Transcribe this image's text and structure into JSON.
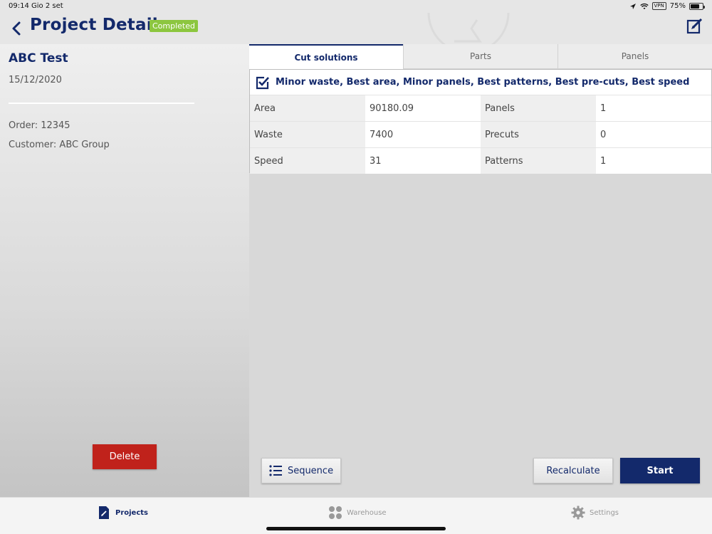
{
  "status_bar": {
    "time": "09:14",
    "date": "Gio 2 set",
    "vpn": "VPN",
    "battery": "75%",
    "battery_level": 0.75
  },
  "header": {
    "title": "Project Detail",
    "badge": "Completed",
    "badge_color": "#8cc63f",
    "accent_color": "#13296b"
  },
  "project": {
    "name": "ABC Test",
    "date": "15/12/2020",
    "order": "Order: 12345",
    "customer": "Customer: ABC Group",
    "delete_label": "Delete"
  },
  "tabs": [
    {
      "label": "Cut solutions",
      "active": true
    },
    {
      "label": "Parts",
      "active": false
    },
    {
      "label": "Panels",
      "active": false
    }
  ],
  "solution": {
    "title": "Minor waste, Best area, Minor panels, Best patterns, Best pre-cuts, Best speed",
    "rows": [
      {
        "label1": "Area",
        "value1": "90180.09",
        "label2": "Panels",
        "value2": "1"
      },
      {
        "label1": "Waste",
        "value1": "7400",
        "label2": "Precuts",
        "value2": "0"
      },
      {
        "label1": "Speed",
        "value1": "31",
        "label2": "Patterns",
        "value2": "1"
      }
    ]
  },
  "actions": {
    "sequence": "Sequence",
    "recalculate": "Recalculate",
    "start": "Start"
  },
  "tabbar": [
    {
      "label": "Projects",
      "icon": "projects-icon",
      "active": true
    },
    {
      "label": "Warehouse",
      "icon": "warehouse-icon",
      "active": false
    },
    {
      "label": "Settings",
      "icon": "gear-icon",
      "active": false
    }
  ]
}
